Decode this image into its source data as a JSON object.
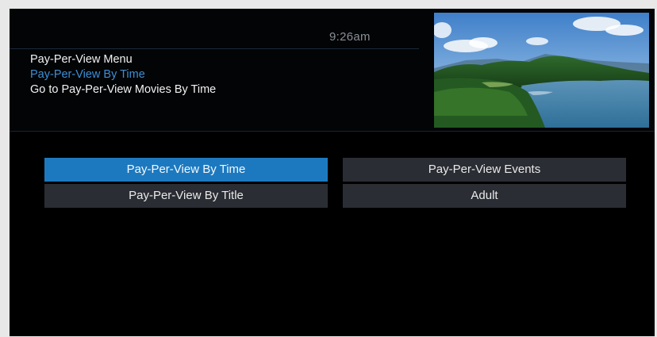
{
  "header": {
    "clock": "9:26am",
    "breadcrumb": {
      "menu": "Pay-Per-View Menu",
      "current": "Pay-Per-View By Time",
      "description": "Go to Pay-Per-View Movies By Time"
    }
  },
  "preview": {
    "content": "landscape-video-preview"
  },
  "menu": {
    "items": [
      {
        "label": "Pay-Per-View By Time",
        "selected": true
      },
      {
        "label": "Pay-Per-View Events",
        "selected": false
      },
      {
        "label": "Pay-Per-View By Title",
        "selected": false
      },
      {
        "label": "Adult",
        "selected": false
      }
    ]
  },
  "colors": {
    "selected_bg": "#1d79bf",
    "button_bg": "#2a2d33",
    "accent_text": "#3d8fd6",
    "background": "#000000"
  }
}
